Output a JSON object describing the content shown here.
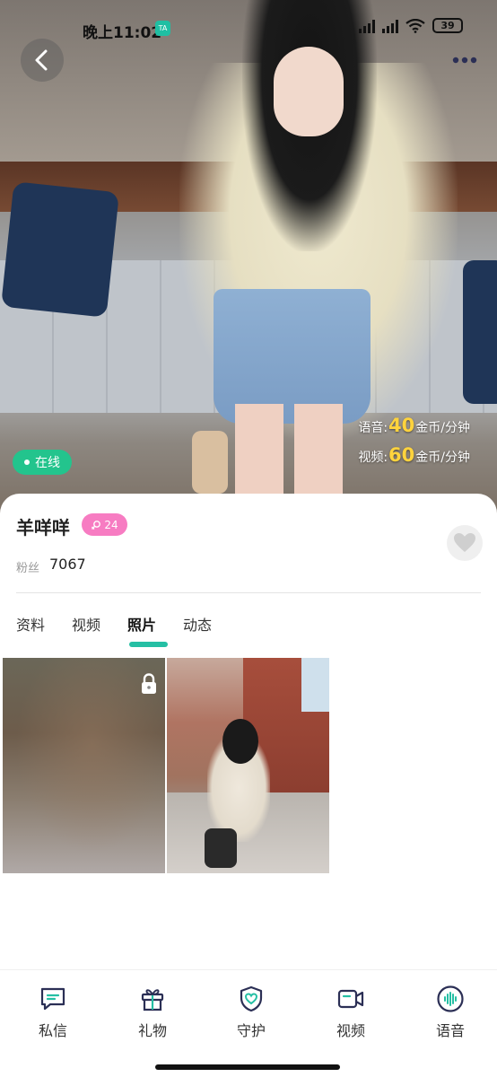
{
  "status_bar": {
    "time": "晚上11:02",
    "battery": "39"
  },
  "profile": {
    "name": "羊咩咩",
    "level": "24",
    "online_label": "在线",
    "fans_label": "粉丝",
    "fans_count": "7067"
  },
  "pricing": {
    "voice_label": "语音:",
    "voice_price": "40",
    "video_label": "视频:",
    "video_price": "60",
    "unit": "金币/分钟"
  },
  "tabs": [
    {
      "label": "资料",
      "active": false
    },
    {
      "label": "视频",
      "active": false
    },
    {
      "label": "照片",
      "active": true
    },
    {
      "label": "动态",
      "active": false
    }
  ],
  "photos": [
    {
      "locked": true
    },
    {
      "locked": false
    }
  ],
  "actions": [
    {
      "label": "私信",
      "icon": "message-icon"
    },
    {
      "label": "礼物",
      "icon": "gift-icon"
    },
    {
      "label": "守护",
      "icon": "shield-heart-icon"
    },
    {
      "label": "视频",
      "icon": "video-camera-icon"
    },
    {
      "label": "语音",
      "icon": "voice-wave-icon"
    }
  ],
  "colors": {
    "accent": "#25bfa4",
    "online": "#23c48d",
    "level_badge": "#f77cc2",
    "price_highlight": "#ffd33d"
  }
}
